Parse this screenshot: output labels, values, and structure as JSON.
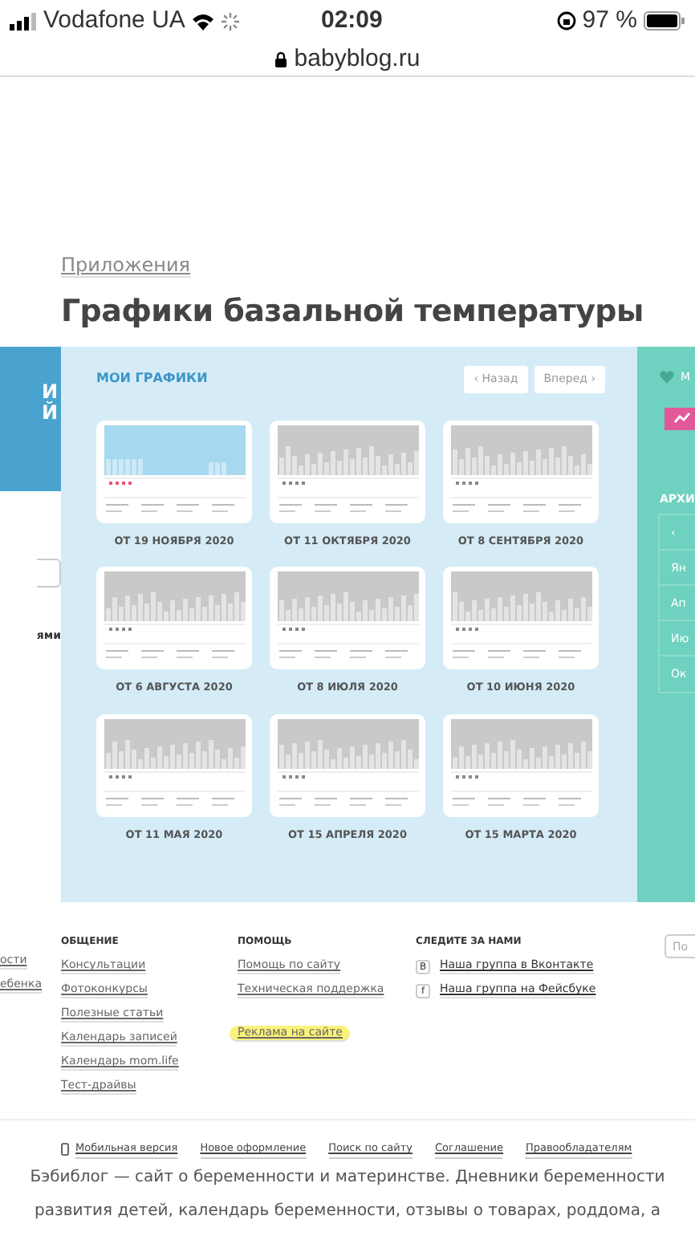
{
  "status_bar": {
    "carrier": "Vodafone UA",
    "time": "02:09",
    "battery": "97 %",
    "url": "babyblog.ru"
  },
  "left_column": {
    "banner_letters": [
      "И",
      "Й"
    ],
    "link": "ями"
  },
  "breadcrumb": "Приложения",
  "title": "Графики базальной температуры",
  "charts_panel": {
    "heading": "МОИ ГРАФИКИ",
    "prev_button": "‹ Назад",
    "next_button": "Вперед ›",
    "charts": [
      {
        "label": "ОТ 19 НОЯБРЯ 2020",
        "highlighted": true
      },
      {
        "label": "ОТ 11 ОКТЯБРЯ 2020",
        "highlighted": false
      },
      {
        "label": "ОТ 8 СЕНТЯБРЯ 2020",
        "highlighted": false
      },
      {
        "label": "ОТ 6 АВГУСТА 2020",
        "highlighted": false
      },
      {
        "label": "ОТ 8 ИЮЛЯ 2020",
        "highlighted": false
      },
      {
        "label": "ОТ 10 ИЮНЯ 2020",
        "highlighted": false
      },
      {
        "label": "ОТ 11 МАЯ 2020",
        "highlighted": false
      },
      {
        "label": "ОТ 15 АПРЕЛЯ 2020",
        "highlighted": false
      },
      {
        "label": "ОТ 15 МАРТА 2020",
        "highlighted": false
      }
    ]
  },
  "right_panel": {
    "top_label": "М",
    "archive_heading": "АРХИ",
    "archive_back": "‹",
    "archive_items": [
      "Ян",
      "Ап",
      "Ию",
      "Ок"
    ]
  },
  "footer": {
    "left_links": [
      "ости",
      "ебенка"
    ],
    "columns": [
      {
        "kind": "links",
        "heading": "ОБЩЕНИЕ",
        "links": [
          {
            "text": "Консультации",
            "highlighted": false
          },
          {
            "text": "Фотоконкурсы",
            "highlighted": false
          },
          {
            "text": "Полезные статьи",
            "highlighted": false
          },
          {
            "text": "Календарь записей",
            "highlighted": false
          },
          {
            "text": "Календарь mom.life",
            "highlighted": false
          },
          {
            "text": "Тест-драйвы",
            "highlighted": false
          }
        ]
      },
      {
        "kind": "links",
        "heading": "ПОМОЩЬ",
        "links": [
          {
            "text": "Помощь по сайту",
            "highlighted": false
          },
          {
            "text": "Техническая поддержка",
            "highlighted": false
          },
          {
            "text": "Реклама на сайте",
            "highlighted": true
          }
        ]
      },
      {
        "kind": "social",
        "heading": "СЛЕДИТЕ ЗА НАМИ",
        "links": [
          {
            "icon": "В",
            "text": "Наша группа в Вконтакте"
          },
          {
            "icon": "f",
            "text": "Наша группа на Фейсбуке"
          }
        ]
      }
    ],
    "search_placeholder": "По",
    "bottom_links": [
      "Мобильная версия",
      "Новое оформление",
      "Поиск по сайту",
      "Соглашение",
      "Правообладателям"
    ],
    "description_lines": [
      "Бэбиблог — сайт о беременности и материнстве. Дневники беременности",
      "развития детей, календарь беременности, отзывы о товарах, роддома, а"
    ]
  }
}
